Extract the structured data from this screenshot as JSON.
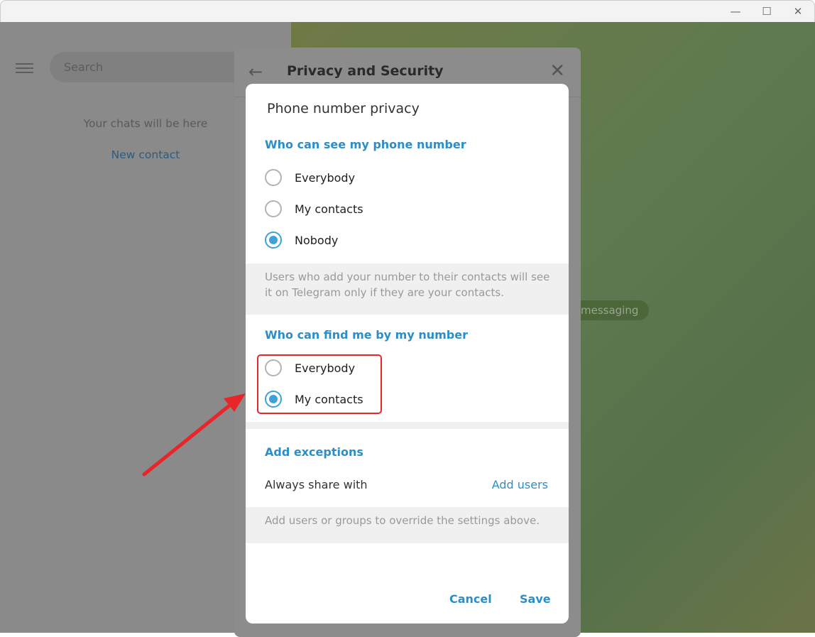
{
  "window": {
    "minimize": "—",
    "maximize": "☐",
    "close": "✕"
  },
  "sidebar": {
    "search_placeholder": "Search",
    "empty_text": "Your chats will be here",
    "new_contact": "New contact"
  },
  "chat": {
    "service_pill": "messaging"
  },
  "settings": {
    "title": "Privacy and Security",
    "back_icon": "arrow-left",
    "close_icon": "close"
  },
  "dialog": {
    "title": "Phone number privacy",
    "see_section": {
      "heading": "Who can see my phone number",
      "options": [
        "Everybody",
        "My contacts",
        "Nobody"
      ],
      "selected": "Nobody",
      "note": "Users who add your number to their contacts will see it on Telegram only if they are your contacts."
    },
    "find_section": {
      "heading": "Who can find me by my number",
      "options": [
        "Everybody",
        "My contacts"
      ],
      "selected": "My contacts"
    },
    "exceptions": {
      "heading": "Add exceptions",
      "always_share_label": "Always share with",
      "add_users": "Add users",
      "note": "Add users or groups to override the settings above."
    },
    "cancel": "Cancel",
    "save": "Save"
  },
  "colors": {
    "accent": "#2c8ec6",
    "radio": "#3ca2dc",
    "highlight": "#e8262a"
  }
}
